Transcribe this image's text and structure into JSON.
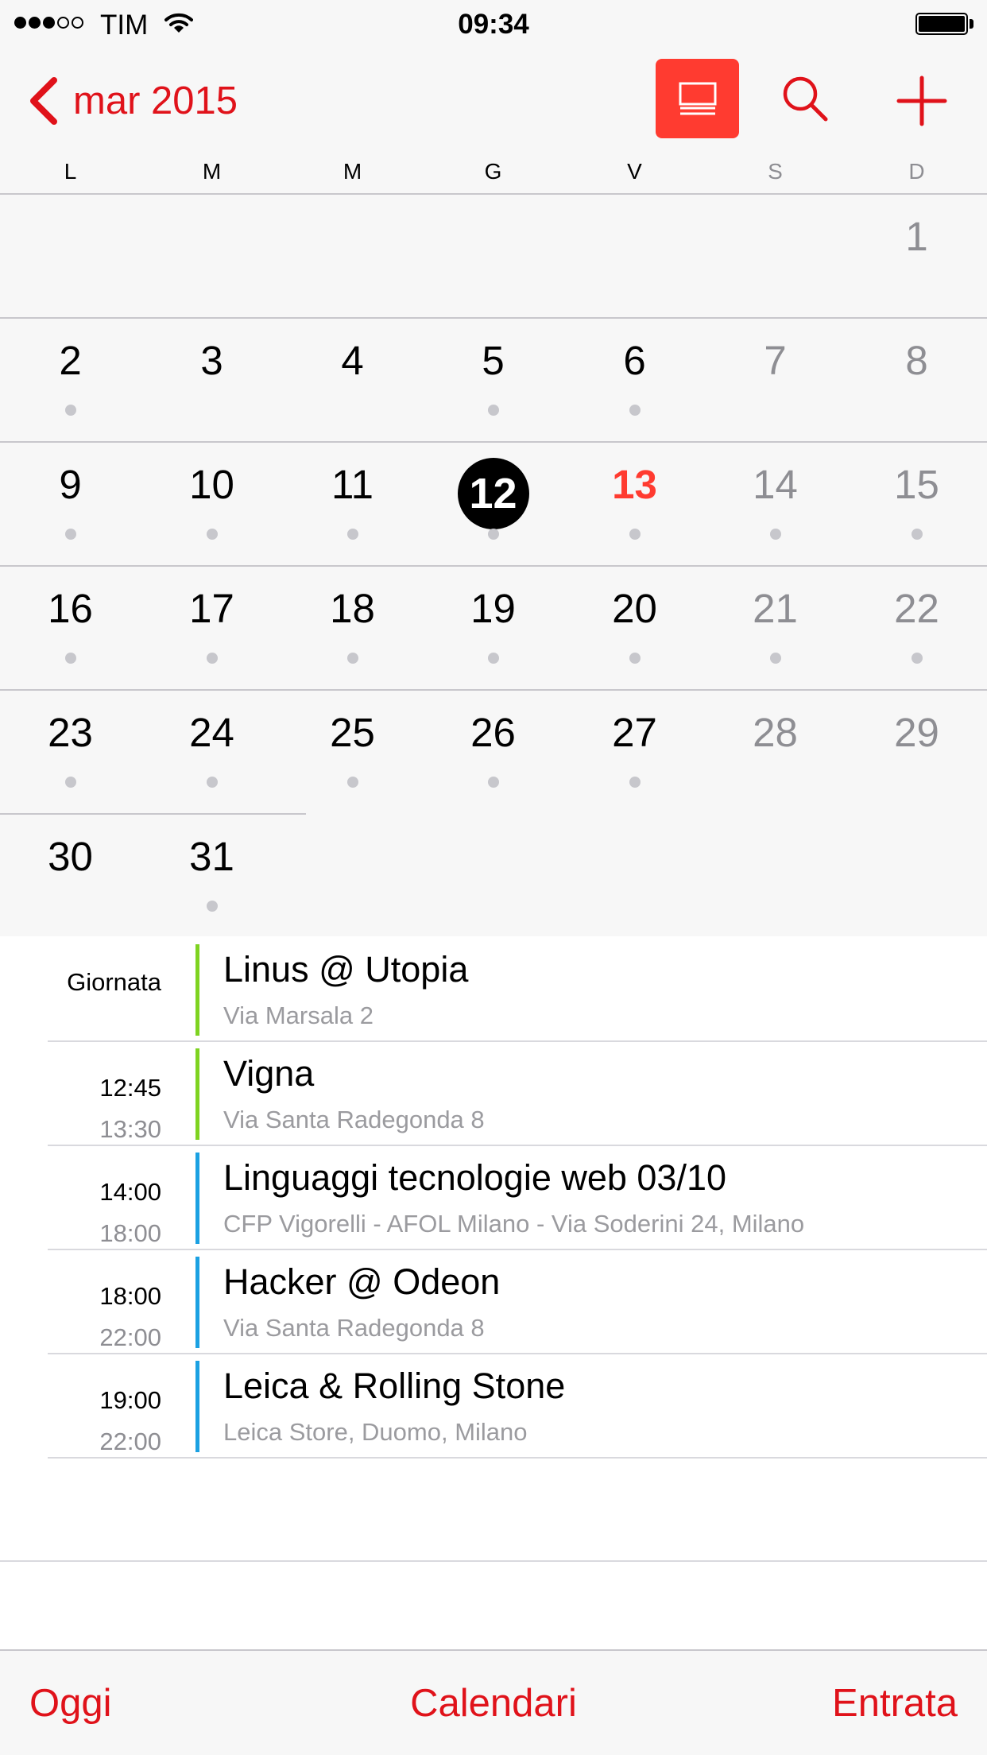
{
  "status_bar": {
    "signal_bars_filled": 3,
    "signal_bars_total": 5,
    "carrier": "TIM",
    "time": "09:34",
    "battery_level": 1.0
  },
  "nav": {
    "month_label": "mar 2015",
    "accent_color": "#e0121a",
    "icons": [
      "chevron-left-icon",
      "list-view-icon",
      "search-icon",
      "plus-icon"
    ]
  },
  "calendar": {
    "weekdays": [
      {
        "label": "L",
        "weekend": false
      },
      {
        "label": "M",
        "weekend": false
      },
      {
        "label": "M",
        "weekend": false
      },
      {
        "label": "G",
        "weekend": false
      },
      {
        "label": "V",
        "weekend": false
      },
      {
        "label": "S",
        "weekend": true
      },
      {
        "label": "D",
        "weekend": true
      }
    ],
    "first_weekday_index": 6,
    "days": [
      {
        "day": "1",
        "has_event": false
      },
      {
        "day": "2",
        "has_event": true
      },
      {
        "day": "3",
        "has_event": false
      },
      {
        "day": "4",
        "has_event": false
      },
      {
        "day": "5",
        "has_event": true
      },
      {
        "day": "6",
        "has_event": true
      },
      {
        "day": "7",
        "has_event": false
      },
      {
        "day": "8",
        "has_event": false
      },
      {
        "day": "9",
        "has_event": true
      },
      {
        "day": "10",
        "has_event": true
      },
      {
        "day": "11",
        "has_event": true
      },
      {
        "day": "12",
        "has_event": true,
        "selected": true
      },
      {
        "day": "13",
        "has_event": true,
        "today": true
      },
      {
        "day": "14",
        "has_event": true
      },
      {
        "day": "15",
        "has_event": true
      },
      {
        "day": "16",
        "has_event": true
      },
      {
        "day": "17",
        "has_event": true
      },
      {
        "day": "18",
        "has_event": true
      },
      {
        "day": "19",
        "has_event": true
      },
      {
        "day": "20",
        "has_event": true
      },
      {
        "day": "21",
        "has_event": true
      },
      {
        "day": "22",
        "has_event": true
      },
      {
        "day": "23",
        "has_event": true
      },
      {
        "day": "24",
        "has_event": true
      },
      {
        "day": "25",
        "has_event": true
      },
      {
        "day": "26",
        "has_event": true
      },
      {
        "day": "27",
        "has_event": true
      },
      {
        "day": "28",
        "has_event": false
      },
      {
        "day": "29",
        "has_event": false
      },
      {
        "day": "30",
        "has_event": false
      },
      {
        "day": "31",
        "has_event": true
      }
    ],
    "selected_color": "#000000",
    "today_color": "#ff3b30"
  },
  "events": [
    {
      "all_day_label": "Giornata",
      "start": "",
      "end": "",
      "title": "Linus @ Utopia",
      "location": "Via Marsala 2",
      "color": "#7ed321"
    },
    {
      "all_day_label": "",
      "start": "12:45",
      "end": "13:30",
      "title": "Vigna",
      "location": "Via Santa Radegonda 8",
      "color": "#7ed321"
    },
    {
      "all_day_label": "",
      "start": "14:00",
      "end": "18:00",
      "title": "Linguaggi  tecnologie web 03/10",
      "location": "CFP Vigorelli - AFOL Milano - Via Soderini 24, Milano",
      "color": "#1ba1e2"
    },
    {
      "all_day_label": "",
      "start": "18:00",
      "end": "22:00",
      "title": "Hacker @ Odeon",
      "location": "Via Santa Radegonda 8",
      "color": "#1ba1e2"
    },
    {
      "all_day_label": "",
      "start": "19:00",
      "end": "22:00",
      "title": "Leica & Rolling Stone",
      "location": "Leica Store, Duomo, Milano",
      "color": "#1ba1e2"
    }
  ],
  "tab_bar": {
    "today": "Oggi",
    "calendars": "Calendari",
    "inbox": "Entrata"
  }
}
